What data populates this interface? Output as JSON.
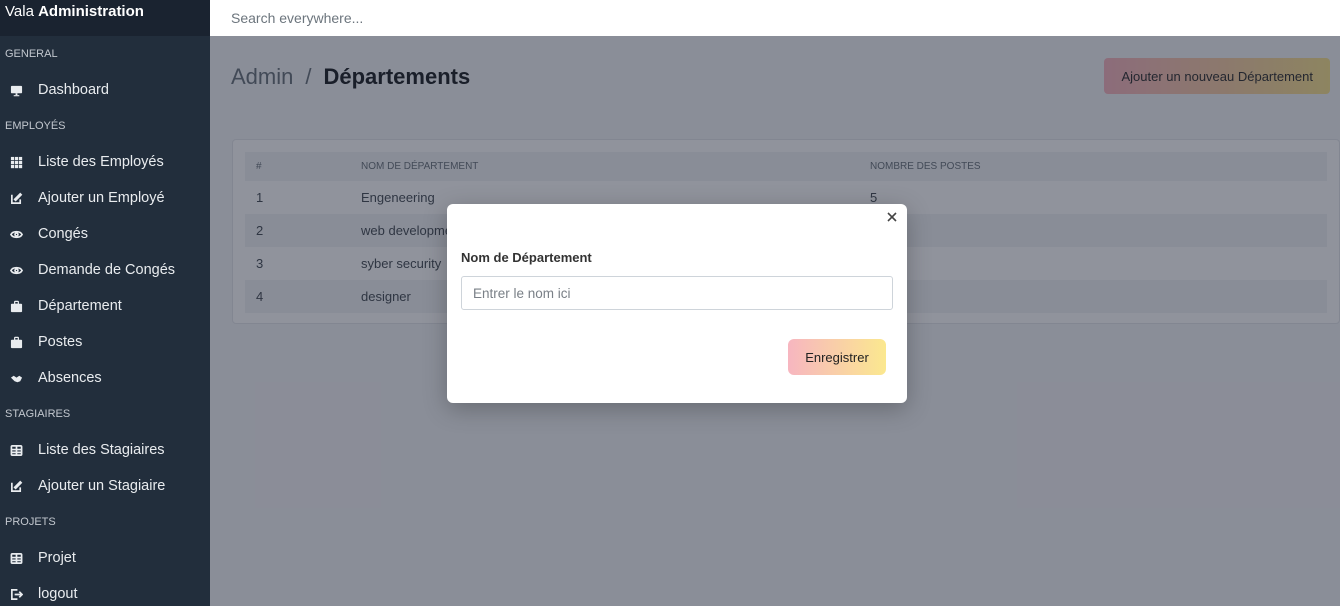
{
  "brand": {
    "prefix": "Vala",
    "name": "Administration"
  },
  "search": {
    "placeholder": "Search everywhere..."
  },
  "sidebar": {
    "sections": [
      {
        "title": "GENERAL",
        "items": [
          {
            "label": "Dashboard",
            "icon": "monitor-icon"
          }
        ]
      },
      {
        "title": "EMPLOYÉS",
        "items": [
          {
            "label": "Liste des Employés",
            "icon": "grid-icon"
          },
          {
            "label": "Ajouter un Employé",
            "icon": "edit-icon"
          },
          {
            "label": "Congés",
            "icon": "eye-icon"
          },
          {
            "label": "Demande de Congés",
            "icon": "eye-icon"
          },
          {
            "label": "Département",
            "icon": "briefcase-icon"
          },
          {
            "label": "Postes",
            "icon": "briefcase-icon"
          },
          {
            "label": "Absences",
            "icon": "handshake-icon"
          }
        ]
      },
      {
        "title": "STAGIAIRES",
        "items": [
          {
            "label": "Liste des Stagiaires",
            "icon": "table-icon"
          },
          {
            "label": "Ajouter un Stagiaire",
            "icon": "edit-icon"
          }
        ]
      },
      {
        "title": "PROJETS",
        "items": [
          {
            "label": "Projet",
            "icon": "table-icon"
          },
          {
            "label": "logout",
            "icon": "logout-icon"
          }
        ]
      }
    ]
  },
  "header": {
    "root": "Admin",
    "separator": "/",
    "current": "Départements"
  },
  "add_button": "Ajouter un nouveau Département",
  "table": {
    "columns": [
      "#",
      "NOM DE DÉPARTEMENT",
      "NOMBRE DES POSTES"
    ],
    "rows": [
      [
        "1",
        "Engeneering",
        "5"
      ],
      [
        "2",
        "web developme",
        ""
      ],
      [
        "3",
        "syber security",
        ""
      ],
      [
        "4",
        "designer",
        ""
      ]
    ]
  },
  "modal": {
    "label": "Nom de Département",
    "placeholder": "Entrer le nom ici",
    "save_label": "Enregistrer",
    "close_icon": "close-icon"
  },
  "colors": {
    "sidebar": "#222e3c",
    "accent_gradient_start": "#f7b6c0",
    "accent_gradient_end": "#f9e48f"
  }
}
